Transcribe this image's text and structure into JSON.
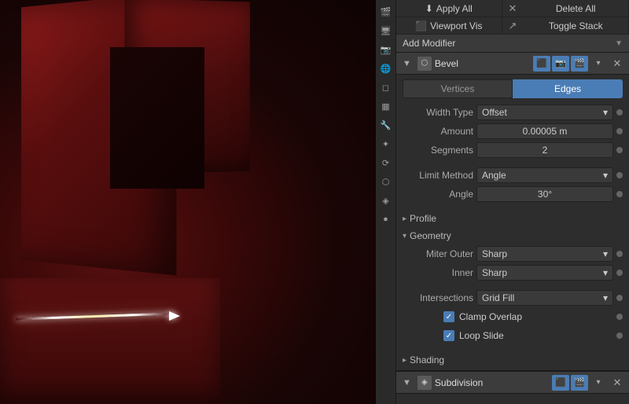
{
  "toolbar": {
    "apply_all": "Apply All",
    "delete_all": "Delete All",
    "viewport_vis": "Viewport Vis",
    "toggle_stack": "Toggle Stack"
  },
  "add_modifier": {
    "label": "Add Modifier",
    "arrow": "▼"
  },
  "bevel_modifier": {
    "name": "Bevel",
    "collapse_icon": "▼",
    "mode_tabs": [
      {
        "label": "Vertices",
        "active": false
      },
      {
        "label": "Edges",
        "active": true
      }
    ],
    "properties": [
      {
        "label": "Width Type",
        "type": "dropdown",
        "value": "Offset"
      },
      {
        "label": "Amount",
        "type": "number",
        "value": "0.00005 m"
      },
      {
        "label": "Segments",
        "type": "number",
        "value": "2"
      }
    ],
    "limit_method": {
      "label": "Limit Method",
      "value": "Angle"
    },
    "angle": {
      "label": "Angle",
      "value": "30°"
    },
    "profile_section": "Profile",
    "geometry_section": "Geometry",
    "geometry_props": [
      {
        "label": "Miter Outer",
        "type": "dropdown",
        "value": "Sharp"
      },
      {
        "label": "Inner",
        "type": "dropdown",
        "value": "Sharp"
      },
      {
        "label": "Intersections",
        "type": "dropdown",
        "value": "Grid Fill"
      }
    ],
    "checkboxes": [
      {
        "label": "Clamp Overlap",
        "checked": true
      },
      {
        "label": "Loop Slide",
        "checked": true
      }
    ],
    "shading_section": "Shading"
  },
  "subdivision_modifier": {
    "name": "Subdivision",
    "collapse_icon": "▼"
  },
  "icons": {
    "close": "✕",
    "check": "✓",
    "chevron_down": "▾",
    "chevron_right": "▸",
    "camera": "📷",
    "gear": "⚙",
    "wrench": "🔧",
    "screen": "🖥",
    "download": "⬇",
    "arrows": "↕"
  }
}
